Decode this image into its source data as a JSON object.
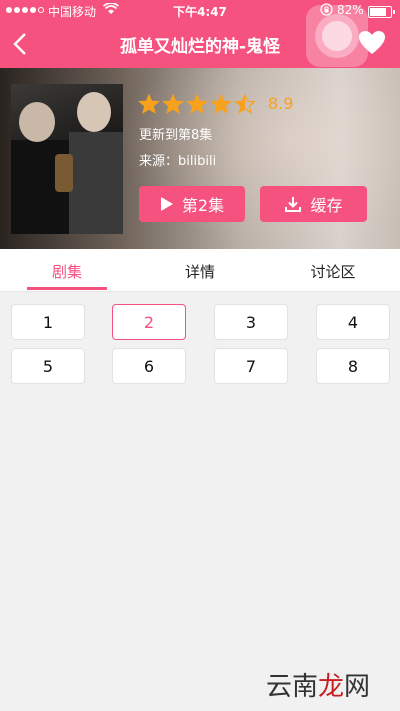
{
  "status_bar": {
    "carrier": "中国移动",
    "time": "下午4:47",
    "battery_percent": "82%"
  },
  "nav": {
    "title": "孤单又灿烂的神-鬼怪"
  },
  "show": {
    "rating": "8.9",
    "star_rating": 4.5,
    "updated": "更新到第8集",
    "source": "来源：bilibili",
    "play_button": "第2集",
    "cache_button": "缓存"
  },
  "tabs": [
    {
      "label": "剧集",
      "active": true
    },
    {
      "label": "详情",
      "active": false
    },
    {
      "label": "讨论区",
      "active": false
    }
  ],
  "episodes": [
    "1",
    "2",
    "3",
    "4",
    "5",
    "6",
    "7",
    "8"
  ],
  "selected_episode": "2",
  "watermark": {
    "text_a": "云南",
    "text_b": "龙",
    "text_c": "网"
  },
  "colors": {
    "accent": "#f5527f",
    "star": "#f6a21f"
  }
}
